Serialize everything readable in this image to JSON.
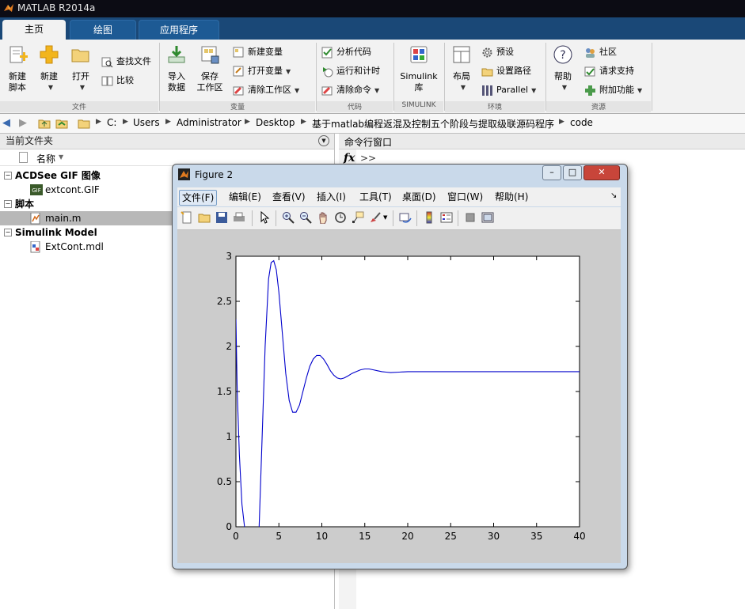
{
  "app": {
    "title": "MATLAB R2014a"
  },
  "tabs": [
    {
      "label": "主页",
      "active": true
    },
    {
      "label": "绘图",
      "active": false
    },
    {
      "label": "应用程序",
      "active": false
    }
  ],
  "ribbon": {
    "file": {
      "new_script": "新建\n脚本",
      "new": "新建",
      "open": "打开",
      "find_files": "查找文件",
      "compare": "比较",
      "group": "文件"
    },
    "variable": {
      "import": "导入\n数据",
      "save": "保存\n工作区",
      "new_var": "新建变量",
      "open_var": "打开变量",
      "clear_ws": "清除工作区",
      "group": "变量"
    },
    "code": {
      "analyze": "分析代码",
      "run_time": "运行和计时",
      "clear_cmd": "清除命令",
      "group": "代码"
    },
    "simulink": {
      "lib": "Simulink\n库",
      "group": "SIMULINK"
    },
    "env": {
      "layout": "布局",
      "prefs": "预设",
      "set_path": "设置路径",
      "parallel": "Parallel",
      "group": "环境"
    },
    "resources": {
      "help": "帮助",
      "community": "社区",
      "support": "请求支持",
      "addons": "附加功能",
      "group": "资源"
    }
  },
  "address": {
    "crumbs": [
      "C:",
      "Users",
      "Administrator",
      "Desktop",
      "基于matlab编程返混及控制五个阶段与提取级联源码程序",
      "code"
    ]
  },
  "current_folder": {
    "title": "当前文件夹",
    "col_name": "名称",
    "groups": [
      {
        "name": "ACDSee GIF 图像",
        "files": [
          "extcont.GIF"
        ]
      },
      {
        "name": "脚本",
        "files": [
          "main.m"
        ]
      },
      {
        "name": "Simulink Model",
        "files": [
          "ExtCont.mdl"
        ]
      }
    ],
    "selected_file": "main.m"
  },
  "command_window": {
    "title": "命令行窗口",
    "fx": "fx",
    "prompt": ">>"
  },
  "figure": {
    "title": "Figure 2",
    "menu": [
      "文件(F)",
      "编辑(E)",
      "查看(V)",
      "插入(I)",
      "工具(T)",
      "桌面(D)",
      "窗口(W)",
      "帮助(H)"
    ],
    "menu_active": "文件(F)"
  },
  "colors": {
    "tabbar": "#1a4877",
    "titlebar": "#0c0c14",
    "line": "#0000cc",
    "figure_bg": "#cccccc"
  },
  "chart_data": {
    "type": "line",
    "title": "",
    "xlabel": "",
    "ylabel": "",
    "xlim": [
      0,
      40
    ],
    "ylim": [
      0,
      3
    ],
    "xticks": [
      "0",
      "5",
      "10",
      "15",
      "20",
      "25",
      "30",
      "35",
      "40"
    ],
    "yticks": [
      "0",
      "0.5",
      "1",
      "1.5",
      "2",
      "2.5",
      "3"
    ],
    "grid": false,
    "series": [
      {
        "color": "#0000cc",
        "x": [
          0,
          0.15,
          0.4,
          0.7,
          1.0,
          1.3,
          1.6,
          2.0,
          2.4,
          2.7,
          3.0,
          3.4,
          3.8,
          4.1,
          4.4,
          4.7,
          5.0,
          5.4,
          5.8,
          6.2,
          6.6,
          7.0,
          7.4,
          7.8,
          8.2,
          8.6,
          9.0,
          9.4,
          9.8,
          10.2,
          10.6,
          11.0,
          11.4,
          11.8,
          12.2,
          12.6,
          13.0,
          13.5,
          14.0,
          14.5,
          15.0,
          15.5,
          16.0,
          16.5,
          17.0,
          17.5,
          18.0,
          19.0,
          20.0,
          22.0,
          25.0,
          30.0,
          35.0,
          40.0
        ],
        "y": [
          2.3,
          1.5,
          0.8,
          0.25,
          0.0,
          -0.2,
          -0.3,
          -0.3,
          -0.2,
          0.0,
          0.85,
          2.0,
          2.75,
          2.93,
          2.95,
          2.85,
          2.6,
          2.15,
          1.7,
          1.4,
          1.27,
          1.27,
          1.35,
          1.5,
          1.65,
          1.78,
          1.86,
          1.9,
          1.9,
          1.86,
          1.8,
          1.73,
          1.68,
          1.65,
          1.64,
          1.65,
          1.67,
          1.7,
          1.72,
          1.74,
          1.75,
          1.75,
          1.74,
          1.73,
          1.72,
          1.715,
          1.71,
          1.715,
          1.72,
          1.72,
          1.72,
          1.72,
          1.72,
          1.72
        ]
      }
    ]
  }
}
